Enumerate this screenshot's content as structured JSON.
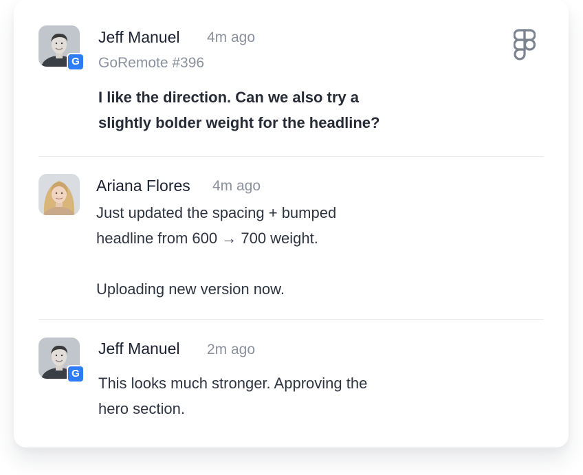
{
  "comments": [
    {
      "author": "Jeff Manuel",
      "time": "4m ago",
      "context": "GoRemote #396",
      "text": "I like the direction. Can we also try a\nslightly bolder weight for the headline?",
      "badge": "G"
    },
    {
      "author": "Ariana Flores",
      "time": "4m ago",
      "text": "Just updated the spacing + bumped\nheadline from 600 → 700 weight.\n\nUploading new version now."
    },
    {
      "author": "Jeff Manuel",
      "time": "2m ago",
      "text": "This looks much stronger. Approving the\nhero section.",
      "badge": "G"
    }
  ],
  "icons": {
    "app": "figma-icon",
    "badge": "goremote-badge-icon"
  },
  "colors": {
    "badge": "#2f7df6",
    "name": "#1a2030",
    "muted": "#8a919c",
    "body": "#2e3440",
    "divider": "#e9ebee"
  }
}
